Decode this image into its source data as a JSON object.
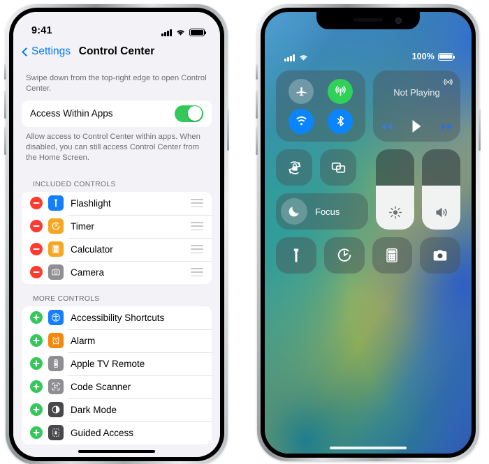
{
  "left_phone": {
    "status_bar": {
      "time": "9:41",
      "signal_icon": "cellular-bars-icon",
      "wifi_icon": "wifi-icon",
      "battery_icon": "battery-full-icon"
    },
    "nav": {
      "back_label": "Settings",
      "back_icon": "chevron-left-icon",
      "title": "Control Center"
    },
    "intro_note": "Swipe down from the top-right edge to open Control Center.",
    "access_row": {
      "label": "Access Within Apps",
      "toggle_state": "on",
      "toggle_color": "#34c759"
    },
    "access_note": "Allow access to Control Center within apps. When disabled, you can still access Control Center from the Home Screen.",
    "included_header": "INCLUDED CONTROLS",
    "included_controls": [
      {
        "label": "Flashlight",
        "icon": "flashlight-icon",
        "icon_color": "#147efb",
        "action": "remove",
        "handle": "drag-handle-icon"
      },
      {
        "label": "Timer",
        "icon": "timer-icon",
        "icon_color": "#f5a623",
        "action": "remove",
        "handle": "drag-handle-icon"
      },
      {
        "label": "Calculator",
        "icon": "calculator-icon",
        "icon_color": "#f5a623",
        "action": "remove",
        "handle": "drag-handle-icon"
      },
      {
        "label": "Camera",
        "icon": "camera-icon",
        "icon_color": "#8e8e93",
        "action": "remove",
        "handle": "drag-handle-icon"
      }
    ],
    "more_header": "MORE CONTROLS",
    "more_controls": [
      {
        "label": "Accessibility Shortcuts",
        "icon": "accessibility-icon",
        "icon_color": "#147efb",
        "action": "add"
      },
      {
        "label": "Alarm",
        "icon": "alarm-clock-icon",
        "icon_color": "#f5870f",
        "action": "add"
      },
      {
        "label": "Apple TV Remote",
        "icon": "tv-remote-icon",
        "icon_color": "#8e8e93",
        "action": "add"
      },
      {
        "label": "Code Scanner",
        "icon": "qr-scanner-icon",
        "icon_color": "#8e8e93",
        "action": "add"
      },
      {
        "label": "Dark Mode",
        "icon": "dark-mode-icon",
        "icon_color": "#48484a",
        "action": "add"
      },
      {
        "label": "Guided Access",
        "icon": "guided-access-icon",
        "icon_color": "#48484a",
        "action": "add"
      }
    ]
  },
  "right_phone": {
    "status_bar": {
      "signal_icon": "cellular-bars-icon",
      "wifi_icon": "wifi-icon",
      "battery_percent": "100%",
      "battery_icon": "battery-full-icon"
    },
    "connectivity": [
      {
        "name": "airplane-mode",
        "icon": "airplane-icon",
        "state": "off",
        "color": "#3d5a84"
      },
      {
        "name": "cellular-data",
        "icon": "cellular-antenna-icon",
        "state": "on",
        "color": "#30d158"
      },
      {
        "name": "wifi",
        "icon": "wifi-icon",
        "state": "on",
        "color": "#0a84ff"
      },
      {
        "name": "bluetooth",
        "icon": "bluetooth-icon",
        "state": "on",
        "color": "#0a84ff"
      }
    ],
    "media": {
      "title": "Not Playing",
      "airplay_icon": "airplay-audio-icon",
      "rewind_icon": "rewind-icon",
      "play_icon": "play-icon",
      "forward_icon": "fast-forward-icon"
    },
    "rotation_lock": {
      "name": "rotation-lock",
      "icon": "rotation-lock-icon",
      "state": "off"
    },
    "screen_mirroring": {
      "name": "screen-mirroring",
      "icon": "screen-mirroring-icon",
      "state": "off"
    },
    "focus": {
      "label": "Focus",
      "icon": "moon-icon",
      "state": "off"
    },
    "brightness_slider": {
      "name": "brightness",
      "icon": "brightness-icon",
      "value": 55
    },
    "volume_slider": {
      "name": "volume",
      "icon": "speaker-waves-icon",
      "value": 55
    },
    "shortcuts": [
      {
        "name": "flashlight",
        "icon": "flashlight-icon"
      },
      {
        "name": "timer",
        "icon": "timer-icon"
      },
      {
        "name": "calculator",
        "icon": "calculator-icon"
      },
      {
        "name": "camera",
        "icon": "camera-icon"
      }
    ]
  }
}
